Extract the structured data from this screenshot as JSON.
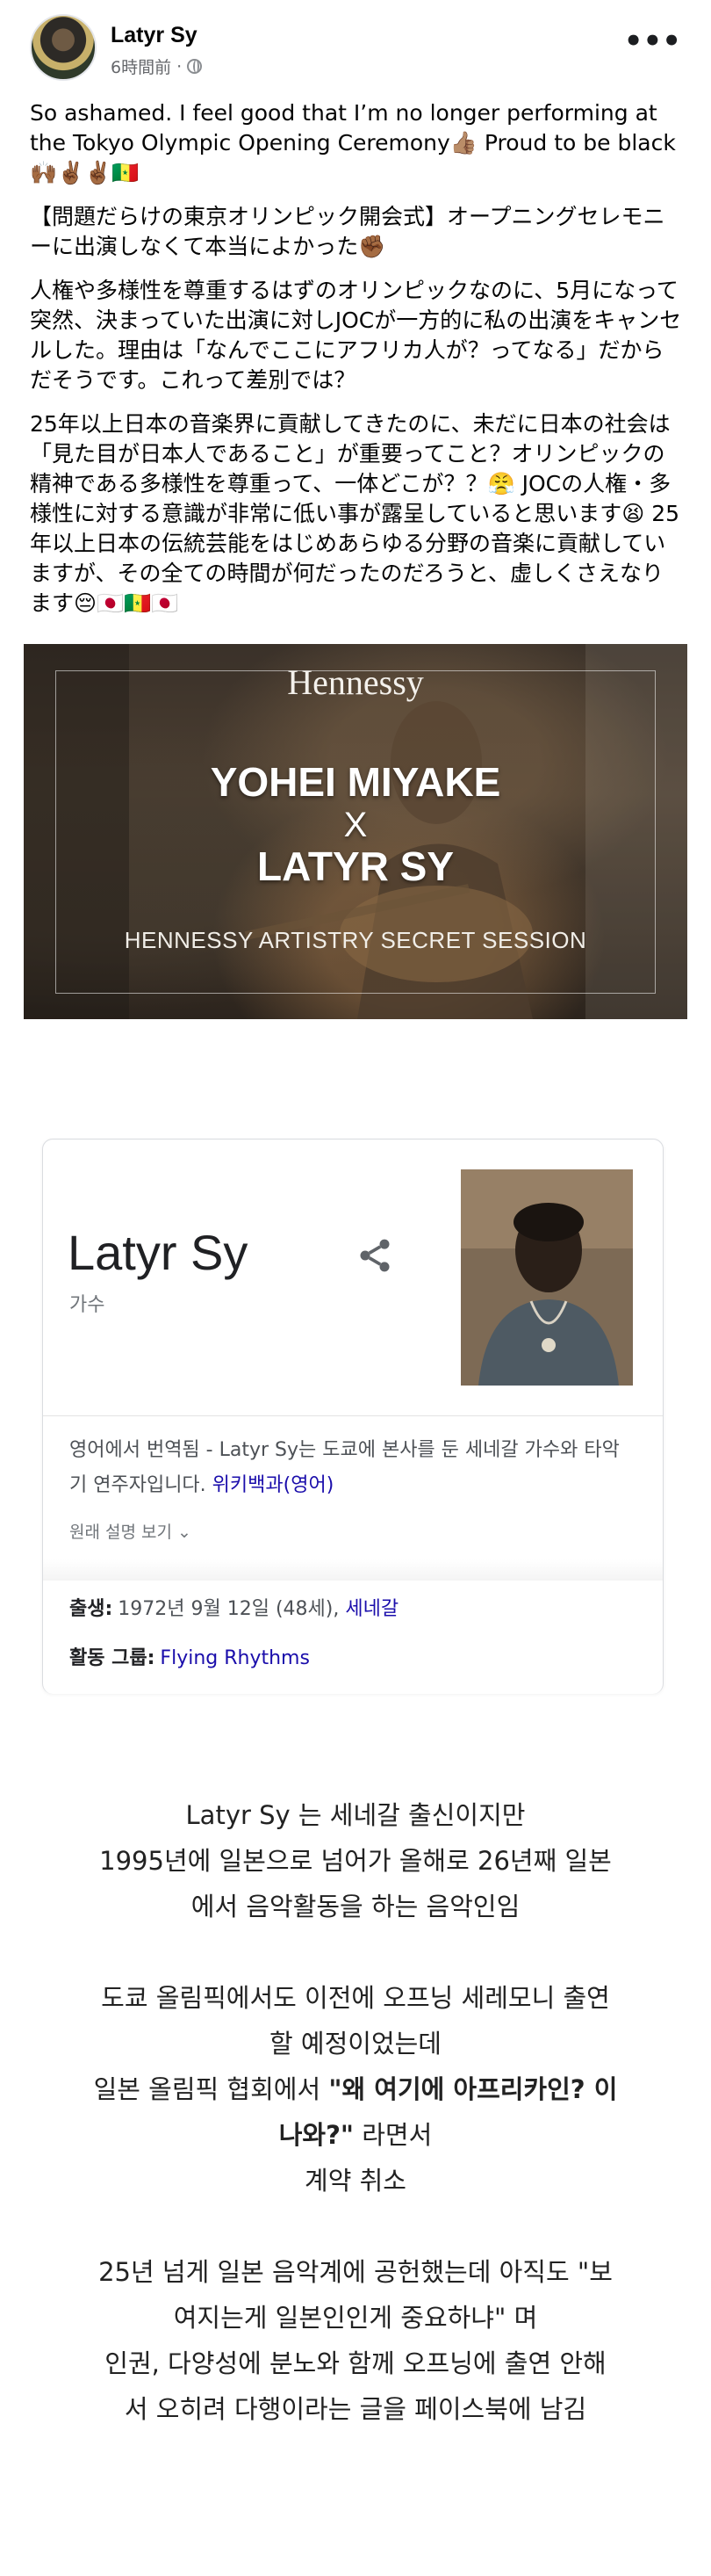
{
  "post": {
    "author": "Latyr Sy",
    "timestamp": "6時間前",
    "separator": "·",
    "paragraphs": [
      "So ashamed. I feel good that I’m no longer performing at the Tokyo Olympic Opening Ceremony👍🏽    Proud to be black 🙌🏾✌🏾✌🏾🇸🇳",
      "【問題だらけの東京オリンピック開会式】オープニングセレモニーに出演しなくて本当によかった✊🏾",
      "人権や多様性を尊重するはずのオリンピックなのに、5月になって突然、決まっていた出演に対しJOCが一方的に私の出演をキャンセルした。理由は「なんでここにアフリカ人が？ってなる」だからだそうです。これって差別では？",
      "25年以上日本の音楽界に貢献してきたのに、未だに日本の社会は「見た目が日本人であること」が重要ってこと？オリンピックの精神である多様性を尊重って、一体どこが？？😤   JOCの人権・多様性に対する意識が非常に低い事が露呈していると思います😫 25年以上日本の伝統芸能をはじめあらゆる分野の音楽に貢献していますが、その全ての時間が何だったのだろうと、虚しくさえなります😔🇯🇵🇸🇳🇯🇵"
    ]
  },
  "video": {
    "brand": "Hennessy",
    "line1": "YOHEI MIYAKE",
    "line2": "X",
    "line3": "LATYR SY",
    "caption": "HENNESSY ARTISTRY SECRET SESSION"
  },
  "knowledge_panel": {
    "title": "Latyr Sy",
    "subtitle": "가수",
    "description": "영어에서 번역됨 - Latyr Sy는 도쿄에 본사를 둔 세네갈 가수와 타악기 연주자입니다. ",
    "wiki_link": "위키백과(영어)",
    "show_original": "원래 설명 보기",
    "born_label": "출생:",
    "born_value": "1972년 9월 12일 (48세), ",
    "born_link": "세네갈",
    "group_label": "활동 그룹:",
    "group_link": "Flying Rhythms"
  },
  "caption": {
    "p1": "Latyr Sy 는 세네갈 출신이지만",
    "p2": "1995년에 일본으로 넘어가 올해로 26년째 일본",
    "p3": "에서 음악활동을 하는 음악인임",
    "p4": "도쿄 올림픽에서도 이전에 오프닝 세레모니 출연",
    "p5": "할 예정이었는데",
    "p6_pre": "일본 올림픽 협회에서 ",
    "p6_bold": "\"왜 여기에 아프리카인? 이",
    "p7_bold": "나와?\"",
    "p7_post": " 라면서",
    "p8": "계약 취소",
    "p9": "25년 넘게 일본 음악계에 공헌했는데 아직도 \"보",
    "p10": "여지는게 일본인인게 중요하냐\" 며",
    "p11": "인권, 다양성에 분노와 함께 오프닝에 출연 안해",
    "p12": "서 오히려 다행이라는 글을 페이스북에 남김"
  }
}
